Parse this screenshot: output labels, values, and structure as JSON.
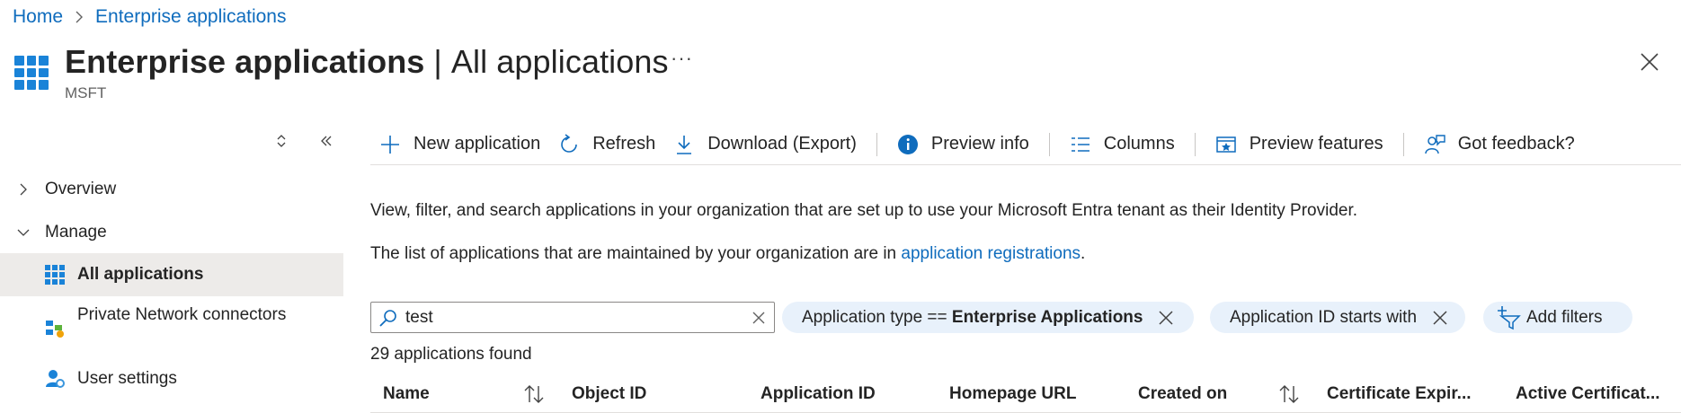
{
  "breadcrumb": {
    "home": "Home",
    "current": "Enterprise applications"
  },
  "header": {
    "title_bold": "Enterprise applications",
    "title_sep": "|",
    "title_rest": "All applications",
    "more": "···",
    "subtitle": "MSFT"
  },
  "nav": {
    "items": [
      {
        "label": "Overview"
      },
      {
        "label": "Manage"
      },
      {
        "label": "All applications"
      },
      {
        "label": "Private Network connectors"
      },
      {
        "label": "User settings"
      }
    ]
  },
  "toolbar": {
    "new_application": "New application",
    "refresh": "Refresh",
    "download": "Download (Export)",
    "preview_info": "Preview info",
    "columns": "Columns",
    "preview_features": "Preview features",
    "feedback": "Got feedback?"
  },
  "description": {
    "line1": "View, filter, and search applications in your organization that are set up to use your Microsoft Entra tenant as their Identity Provider.",
    "line2_prefix": "The list of applications that are maintained by your organization are in",
    "line2_link": "application registrations",
    "line2_suffix": "."
  },
  "search": {
    "value": "test"
  },
  "filters": {
    "app_type_prefix": "Application type ==",
    "app_type_value": "Enterprise Applications",
    "app_id": "Application ID starts with",
    "add_filters": "Add filters"
  },
  "results": {
    "count_text": "29 applications found"
  },
  "table": {
    "columns": [
      "Name",
      "Object ID",
      "Application ID",
      "Homepage URL",
      "Created on",
      "Certificate Expir...",
      "Active Certificat..."
    ]
  },
  "colors": {
    "accent": "#0f6cbd",
    "icon_blue": "#1a83d8",
    "pill_bg": "#e8f1fb",
    "selected_bg": "#edebe9"
  }
}
